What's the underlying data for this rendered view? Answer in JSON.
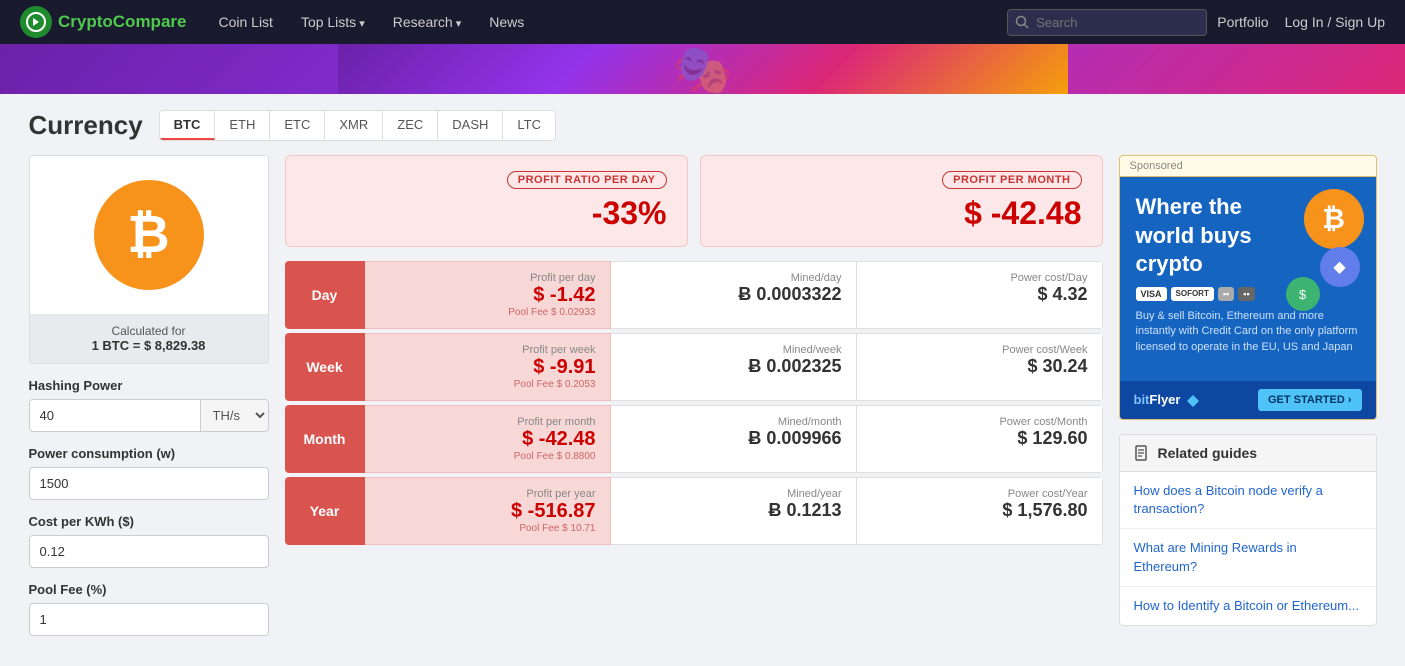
{
  "navbar": {
    "logo_text_normal": "Crypto",
    "logo_text_colored": "Compare",
    "nav_items": [
      {
        "id": "coin-list",
        "label": "Coin List",
        "has_arrow": false
      },
      {
        "id": "top-lists",
        "label": "Top Lists",
        "has_arrow": true
      },
      {
        "id": "research",
        "label": "Research",
        "has_arrow": true
      },
      {
        "id": "news",
        "label": "News",
        "has_arrow": false
      }
    ],
    "search_placeholder": "Search",
    "portfolio_label": "Portfolio",
    "login_label": "Log In / Sign Up"
  },
  "currency": {
    "title": "Currency",
    "tabs": [
      "BTC",
      "ETH",
      "ETC",
      "XMR",
      "ZEC",
      "DASH",
      "LTC"
    ],
    "active_tab": "BTC"
  },
  "coin": {
    "symbol": "₿",
    "calculated_for_label": "Calculated for",
    "btc_value_label": "1 BTC = $ 8,829.38"
  },
  "form": {
    "hashing_power_label": "Hashing Power",
    "hashing_power_value": "40",
    "hashing_power_unit": "TH/s",
    "power_consumption_label": "Power consumption (w)",
    "power_consumption_value": "1500",
    "cost_per_kwh_label": "Cost per KWh ($)",
    "cost_per_kwh_value": "0.12",
    "pool_fee_label": "Pool Fee (%)",
    "pool_fee_value": "1"
  },
  "profit_summary": {
    "day_label": "PROFIT RATIO PER DAY",
    "day_value": "-33%",
    "month_label": "PROFIT PER MONTH",
    "month_value": "$ -42.48"
  },
  "data_rows": [
    {
      "period": "Day",
      "profit_header": "Profit per day",
      "profit_value": "$ -1.42",
      "pool_fee": "Pool Fee $ 0.02933",
      "mined_header": "Mined/day",
      "mined_value": "Ƀ 0.0003322",
      "power_header": "Power cost/Day",
      "power_value": "$ 4.32"
    },
    {
      "period": "Week",
      "profit_header": "Profit per week",
      "profit_value": "$ -9.91",
      "pool_fee": "Pool Fee $ 0.2053",
      "mined_header": "Mined/week",
      "mined_value": "Ƀ 0.002325",
      "power_header": "Power cost/Week",
      "power_value": "$ 30.24"
    },
    {
      "period": "Month",
      "profit_header": "Profit per month",
      "profit_value": "$ -42.48",
      "pool_fee": "Pool Fee $ 0.8800",
      "mined_header": "Mined/month",
      "mined_value": "Ƀ 0.009966",
      "power_header": "Power cost/Month",
      "power_value": "$ 129.60"
    },
    {
      "period": "Year",
      "profit_header": "Profit per year",
      "profit_value": "$ -516.87",
      "pool_fee": "Pool Fee $ 10.71",
      "mined_header": "Mined/year",
      "mined_value": "Ƀ 0.1213",
      "power_header": "Power cost/Year",
      "power_value": "$ 1,576.80"
    }
  ],
  "ad": {
    "sponsored_label": "Sponsored",
    "title": "Where the world buys crypto",
    "payment_icons": [
      "VISA",
      "SOFORT",
      ""
    ],
    "description": "Buy & sell Bitcoin, Ethereum and more instantly with Credit Card on the only platform licensed to operate in the EU, US and Japan",
    "brand": "bitFlyer",
    "cta_button": "GET STARTED ›"
  },
  "related_guides": {
    "section_title": "Related guides",
    "items": [
      "How does a Bitcoin node verify a transaction?",
      "What are Mining Rewards in Ethereum?",
      "How to Identify a Bitcoin or Ethereum..."
    ]
  }
}
